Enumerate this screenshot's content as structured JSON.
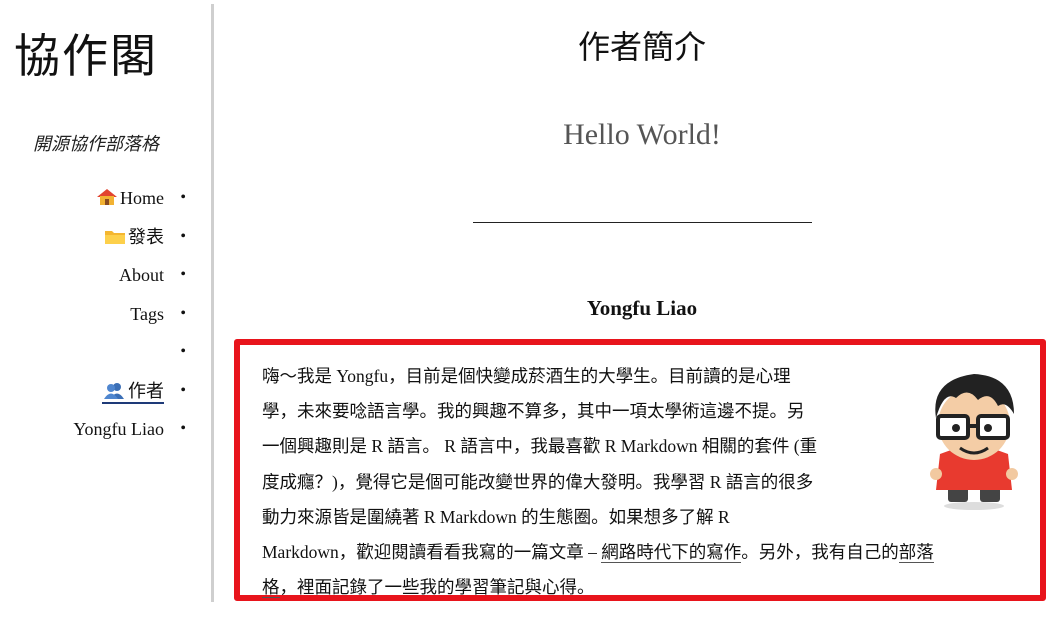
{
  "sidebar": {
    "site_title": "協作閣",
    "site_subtitle": "開源協作部落格",
    "nav": [
      {
        "icon": "house-icon",
        "label": "Home"
      },
      {
        "icon": "folder-icon",
        "label": "發表"
      },
      {
        "icon": "",
        "label": "About"
      },
      {
        "icon": "",
        "label": "Tags"
      },
      {
        "icon": "",
        "label": ""
      },
      {
        "icon": "people-icon",
        "label": "作者"
      },
      {
        "icon": "",
        "label": "Yongfu Liao"
      }
    ]
  },
  "main": {
    "page_title": "作者簡介",
    "greeting": "Hello World!",
    "author_name": "Yongfu Liao",
    "bio": {
      "line1": "嗨〜我是 Yongfu，目前是個快變成菸酒生的大學生。目前讀的是心理",
      "line2": "學，未來要唸語言學。我的興趣不算多，其中一項太學術這邊不提。另",
      "line3": "一個興趣則是 R 語言。 R 語言中，我最喜歡 R Markdown 相關的套件 (重",
      "line4": "度成癮？)，覺得它是個可能改變世界的偉大發明。我學習 R 語言的很多",
      "line5": "動力來源皆是圍繞著 R Markdown 的生態圈。如果想多了解 R",
      "line6_pre": "Markdown，歡迎閱讀看看我寫的一篇文章 – ",
      "line6_link": "網路時代下的寫作",
      "line6_mid": "。另外，我有自己的",
      "line6_link2": "部落",
      "line7_link": "格",
      "line7_post": "，裡面記錄了一些我的學習筆記與心得。"
    },
    "avatar": "cartoon-avatar"
  },
  "colors": {
    "highlight_border": "#e8141c",
    "active_underline": "#1e3a78"
  }
}
